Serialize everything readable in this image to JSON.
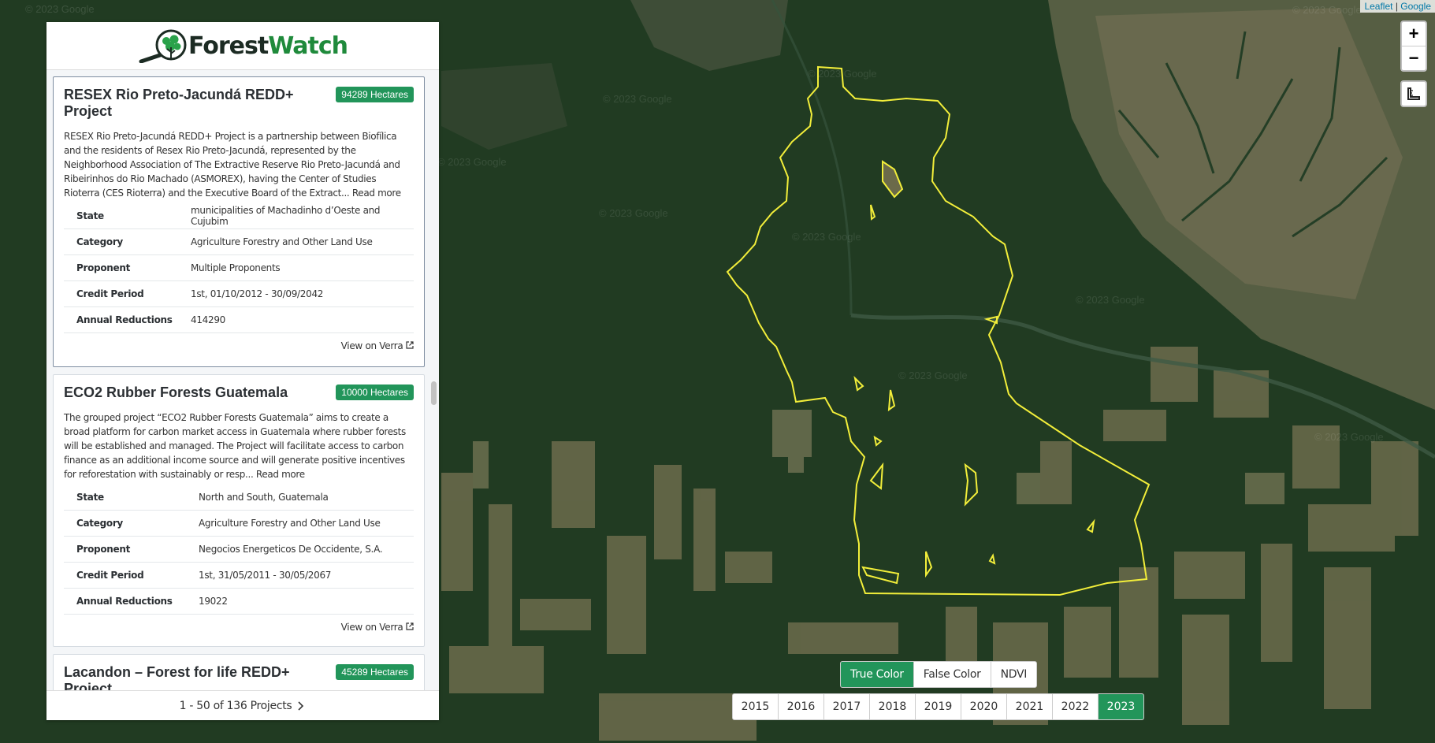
{
  "app": {
    "logo_part1": "Forest",
    "logo_part2": "Watch",
    "logo_icon": "magnifier-tree-icon"
  },
  "map": {
    "attribution_leaflet": "Leaflet",
    "attribution_sep": "|",
    "attribution_google": "Google",
    "watermark": "© 2023 Google",
    "zoom_in": "+",
    "zoom_out": "−",
    "measure_icon": "ruler-icon",
    "boundary_color": "#f2ee3a"
  },
  "projects": [
    {
      "title": "RESEX Rio Preto-Jacundá REDD+ Project",
      "hectares": "94289 Hectares",
      "description": "RESEX Rio Preto-Jacundá REDD+ Project is a partnership between Biofílica and the residents of Resex Rio Preto-Jacundá, represented by the Neighborhood Association of The Extractive Reserve Rio Preto-Jacundá and Ribeirinhos do Rio Machado (ASMOREX), having the Center of Studies Rioterra (CES Rioterra) and the Executive Board of the Extract...",
      "read_more": "Read more",
      "fields": [
        {
          "label": "State",
          "value": "municipalities of Machadinho d’Oeste and Cujubim"
        },
        {
          "label": "Category",
          "value": "Agriculture Forestry and Other Land Use"
        },
        {
          "label": "Proponent",
          "value": "Multiple Proponents"
        },
        {
          "label": "Credit Period",
          "value": "1st, 01/10/2012 - 30/09/2042"
        },
        {
          "label": "Annual Reductions",
          "value": "414290"
        }
      ],
      "link": "View on Verra"
    },
    {
      "title": "ECO2 Rubber Forests Guatemala",
      "hectares": "10000 Hectares",
      "description": "The grouped project “ECO2 Rubber Forests Guatemala” aims to create a broad platform for carbon market access in Guatemala where rubber forests will be established and managed. The Project will facilitate access to carbon finance as an additional income source and will generate positive incentives for reforestation with sustainably or resp...",
      "read_more": "Read more",
      "fields": [
        {
          "label": "State",
          "value": "North and South, Guatemala"
        },
        {
          "label": "Category",
          "value": "Agriculture Forestry and Other Land Use"
        },
        {
          "label": "Proponent",
          "value": "Negocios Energeticos De Occidente, S.A."
        },
        {
          "label": "Credit Period",
          "value": "1st, 31/05/2011 - 30/05/2067"
        },
        {
          "label": "Annual Reductions",
          "value": "19022"
        }
      ],
      "link": "View on Verra"
    },
    {
      "title": "Lacandon – Forest for life REDD+ Project",
      "hectares": "45289 Hectares"
    }
  ],
  "pagination": {
    "text": "1 - 50 of 136 Projects",
    "next_icon": "chevron-right-icon"
  },
  "view_modes": [
    "True Color",
    "False Color",
    "NDVI"
  ],
  "selected_mode": "True Color",
  "years": [
    "2015",
    "2016",
    "2017",
    "2018",
    "2019",
    "2020",
    "2021",
    "2022",
    "2023"
  ],
  "selected_year": "2023"
}
